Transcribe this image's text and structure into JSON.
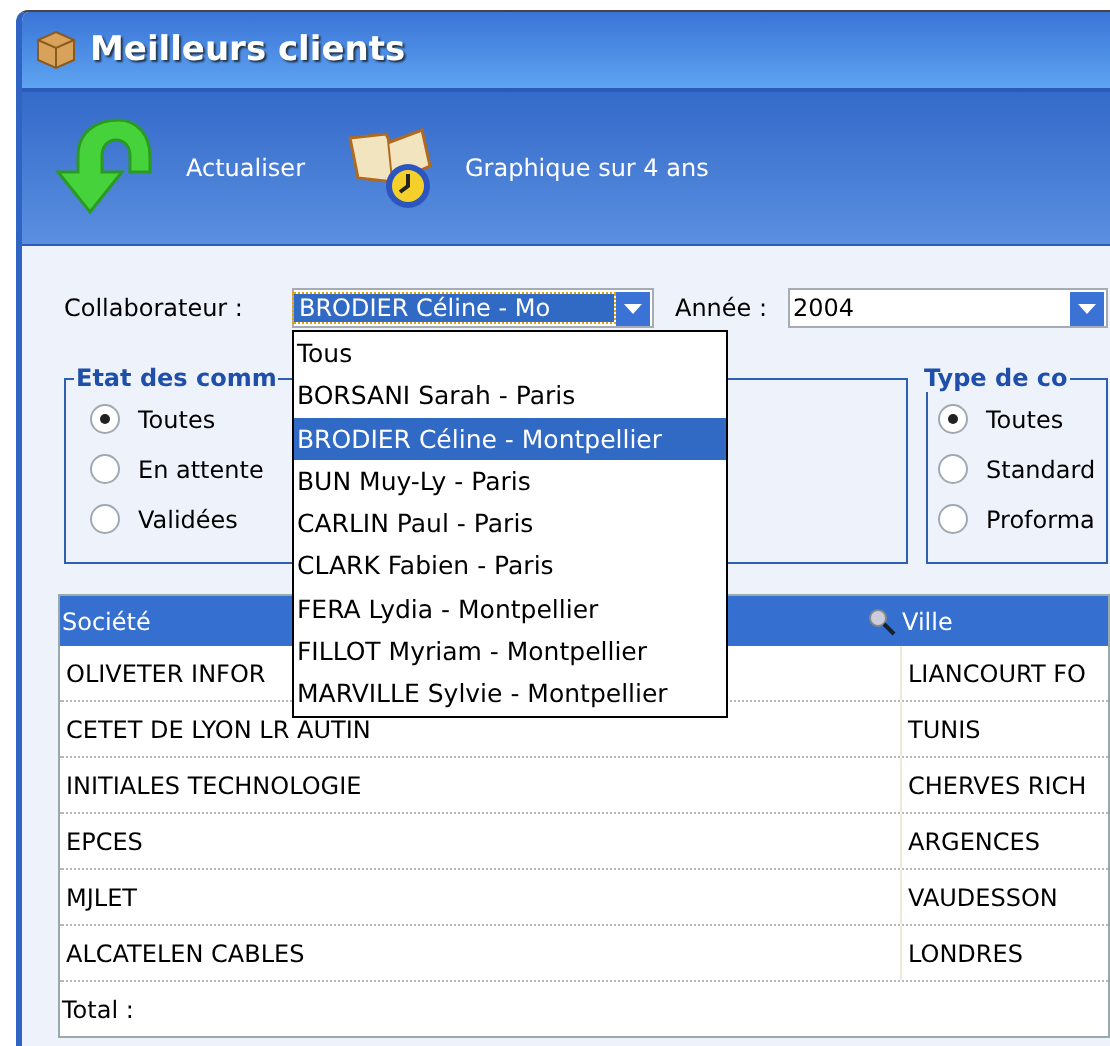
{
  "window": {
    "title": "Meilleurs clients"
  },
  "toolbar": [
    {
      "label": "Actualiser",
      "kind": "refresh"
    },
    {
      "label": "Graphique sur 4 ans",
      "kind": "chart"
    }
  ],
  "filters": {
    "collaborateur": {
      "label": "Collaborateur :",
      "value": "BRODIER Céline - Mo",
      "expanded": true,
      "options": [
        {
          "label": "Tous",
          "selected": false
        },
        {
          "label": "BORSANI Sarah - Paris",
          "selected": false
        },
        {
          "label": "BRODIER Céline - Montpellier",
          "selected": true
        },
        {
          "label": "BUN Muy-Ly - Paris",
          "selected": false
        },
        {
          "label": "CARLIN Paul - Paris",
          "selected": false
        },
        {
          "label": "CLARK Fabien - Paris",
          "selected": false
        },
        {
          "label": "FERA Lydia - Montpellier",
          "selected": false
        },
        {
          "label": "FILLOT Myriam - Montpellier",
          "selected": false
        },
        {
          "label": "MARVILLE Sylvie - Montpellier",
          "selected": false
        }
      ]
    },
    "annee": {
      "label": "Année :",
      "value": "2004"
    }
  },
  "groups": [
    {
      "legend": "Etat des comm",
      "options": [
        {
          "label": "Toutes",
          "selected": true
        },
        {
          "label": "En attente",
          "selected": false
        },
        {
          "label": "Validées",
          "selected": false
        }
      ]
    },
    {
      "legend": "Type de co",
      "options": [
        {
          "label": "Toutes",
          "selected": true
        },
        {
          "label": "Standard",
          "selected": false
        },
        {
          "label": "Proforma",
          "selected": false
        }
      ]
    }
  ],
  "table": {
    "columns": [
      "Société",
      "Ville"
    ],
    "rows": [
      [
        "OLIVETER INFOR",
        "LIANCOURT FO"
      ],
      [
        "CETET DE LYON LR AUTIN",
        "TUNIS"
      ],
      [
        "INITIALES TECHNOLOGIE",
        "CHERVES RICH"
      ],
      [
        "EPCES",
        "ARGENCES"
      ],
      [
        "MJLET",
        "VAUDESSON"
      ],
      [
        "ALCATELEN CABLES",
        "LONDRES"
      ]
    ],
    "total_label": "Total :"
  }
}
